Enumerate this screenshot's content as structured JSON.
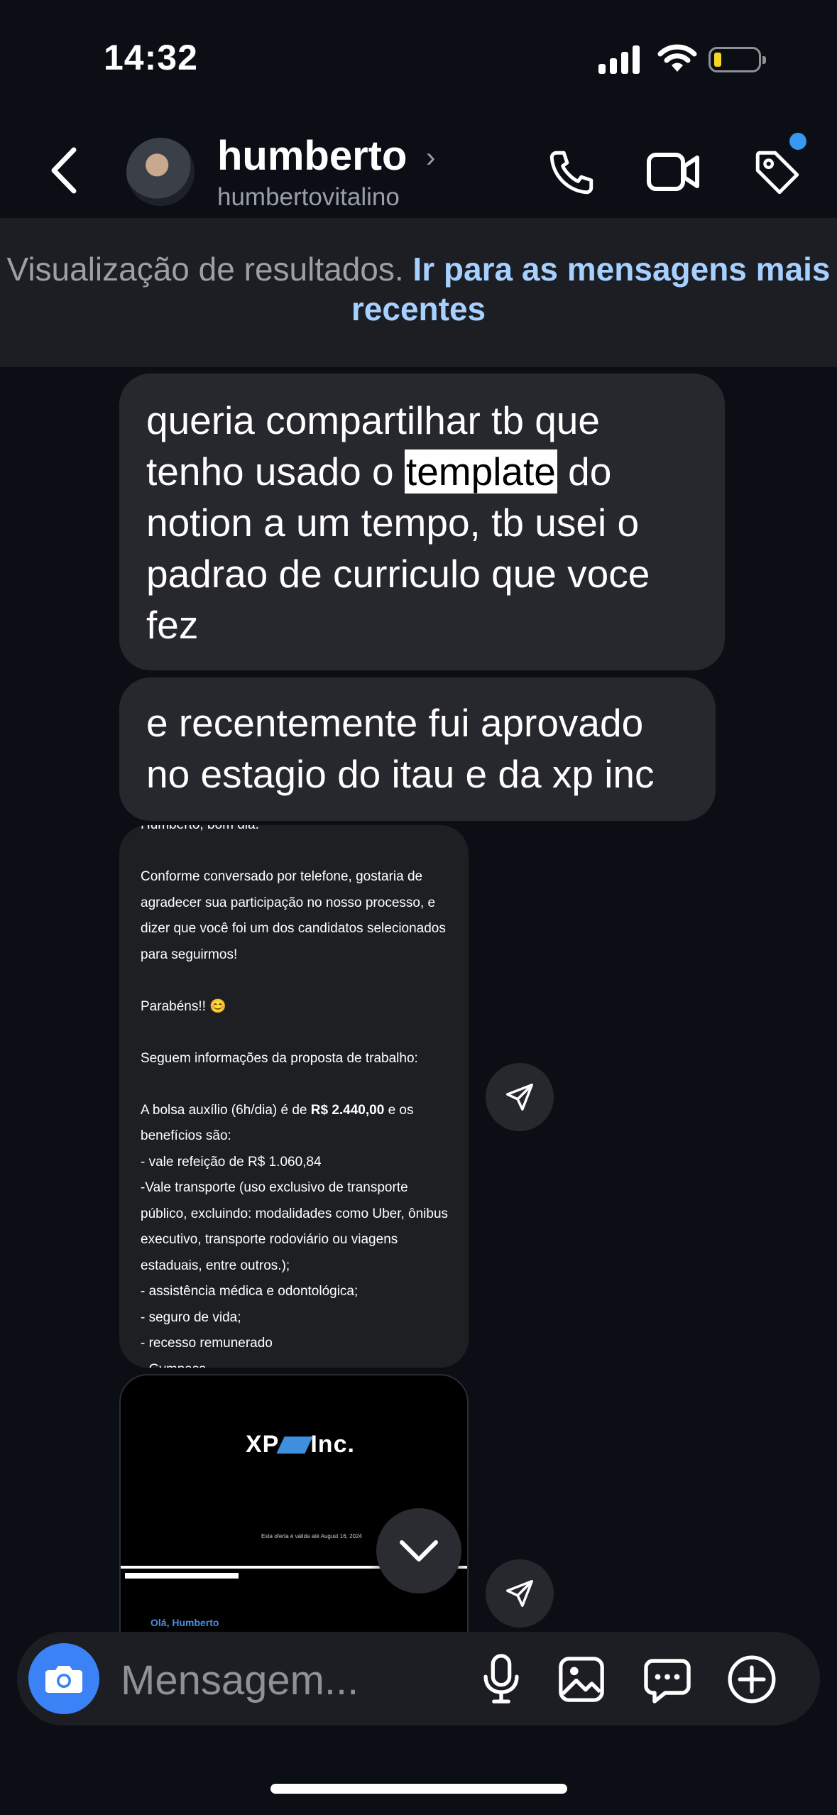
{
  "status_bar": {
    "time": "14:32",
    "battery_color": "#f5d327"
  },
  "header": {
    "username": "humberto",
    "handle": "humbertovitalino",
    "icons": [
      "back-icon",
      "phone-icon",
      "video-icon",
      "tag-icon"
    ]
  },
  "banner": {
    "text": "Visualização de resultados. ",
    "link": "Ir para as mensagens mais recentes"
  },
  "messages": {
    "m1": {
      "before": "queria compartilhar tb que tenho usado o ",
      "highlight": "template",
      "after": " do notion a um tempo, tb usei o padrao de curriculo que voce fez"
    },
    "m2": "e recentemente fui aprovado no estagio do itau e da xp inc",
    "email": {
      "greeting": "Humberto, bom dia.",
      "p1": "Conforme conversado por telefone, gostaria de agradecer sua participação no nosso processo, e dizer que você foi um dos candidatos selecionados para seguirmos!",
      "p2": "Parabéns!! 😊",
      "p3": "Seguem informações da proposta de trabalho:",
      "p4a": "A bolsa auxílio (6h/dia) é de ",
      "p4b": "R$ 2.440,00",
      "p4c": " e os benefícios são:",
      "l1": "- vale refeição de R$ 1.060,84",
      "l2": "-Vale transporte (uso exclusivo de transporte público, excluindo: modalidades como Uber, ônibus executivo, transporte rodoviário ou viagens estaduais, entre outros.);",
      "l3": "- assistência médica e odontológica;",
      "l4": "- seguro de vida;",
      "l5": "- recesso remunerado",
      "l6": "- Gympass"
    },
    "pdf": {
      "logo_left": "XP",
      "logo_right": "Inc.",
      "small": "Esta oferta é válida até August 16, 2024",
      "hello": "Olá, Humberto"
    }
  },
  "composer": {
    "placeholder": "Mensagem...",
    "accent": "#3b82f6"
  }
}
